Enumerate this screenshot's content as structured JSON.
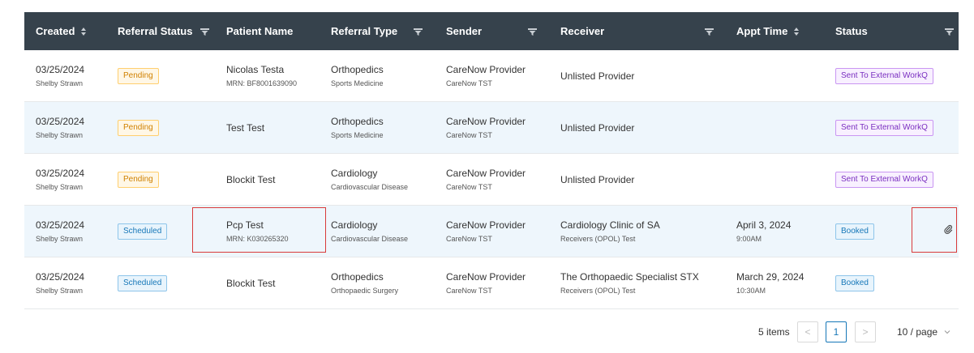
{
  "headers": {
    "created": "Created",
    "referral_status": "Referral Status",
    "patient_name": "Patient Name",
    "referral_type": "Referral Type",
    "sender": "Sender",
    "receiver": "Receiver",
    "appt_time": "Appt Time",
    "status": "Status"
  },
  "rows": [
    {
      "created": "03/25/2024",
      "creator": "Shelby Strawn",
      "referral_status": "Pending",
      "patient_name": "Nicolas Testa",
      "mrn": "MRN: BF8001639090",
      "referral_type": "Orthopedics",
      "specialty": "Sports Medicine",
      "sender": "CareNow Provider",
      "sender_org": "CareNow TST",
      "receiver": "Unlisted Provider",
      "receiver_org": "",
      "appt_date": "",
      "appt_time": "",
      "status": "Sent To External WorkQ"
    },
    {
      "created": "03/25/2024",
      "creator": "Shelby Strawn",
      "referral_status": "Pending",
      "patient_name": "Test Test",
      "mrn": "",
      "referral_type": "Orthopedics",
      "specialty": "Sports Medicine",
      "sender": "CareNow Provider",
      "sender_org": "CareNow TST",
      "receiver": "Unlisted Provider",
      "receiver_org": "",
      "appt_date": "",
      "appt_time": "",
      "status": "Sent To External WorkQ"
    },
    {
      "created": "03/25/2024",
      "creator": "Shelby Strawn",
      "referral_status": "Pending",
      "patient_name": "Blockit Test",
      "mrn": "",
      "referral_type": "Cardiology",
      "specialty": "Cardiovascular Disease",
      "sender": "CareNow Provider",
      "sender_org": "CareNow TST",
      "receiver": "Unlisted Provider",
      "receiver_org": "",
      "appt_date": "",
      "appt_time": "",
      "status": "Sent To External WorkQ"
    },
    {
      "created": "03/25/2024",
      "creator": "Shelby Strawn",
      "referral_status": "Scheduled",
      "patient_name": "Pcp Test",
      "mrn": "MRN: K030265320",
      "referral_type": "Cardiology",
      "specialty": "Cardiovascular Disease",
      "sender": "CareNow Provider",
      "sender_org": "CareNow TST",
      "receiver": "Cardiology Clinic of SA",
      "receiver_org": "Receivers (OPOL) Test",
      "appt_date": "April 3, 2024",
      "appt_time": "9:00AM",
      "status": "Booked"
    },
    {
      "created": "03/25/2024",
      "creator": "Shelby Strawn",
      "referral_status": "Scheduled",
      "patient_name": "Blockit Test",
      "mrn": "",
      "referral_type": "Orthopedics",
      "specialty": "Orthopaedic Surgery",
      "sender": "CareNow Provider",
      "sender_org": "CareNow TST",
      "receiver": "The Orthopaedic Specialist STX",
      "receiver_org": "Receivers (OPOL) Test",
      "appt_date": "March 29, 2024",
      "appt_time": "10:30AM",
      "status": "Booked"
    }
  ],
  "attachment_icon": "paperclip-icon",
  "pagination": {
    "total": "5 items",
    "prev": "<",
    "current_page": "1",
    "next": ">",
    "page_size": "10 / page"
  },
  "colors": {
    "header_bg": "#36424c",
    "highlight_row": "#eef6fc",
    "annotation_box": "#d93a3a"
  }
}
